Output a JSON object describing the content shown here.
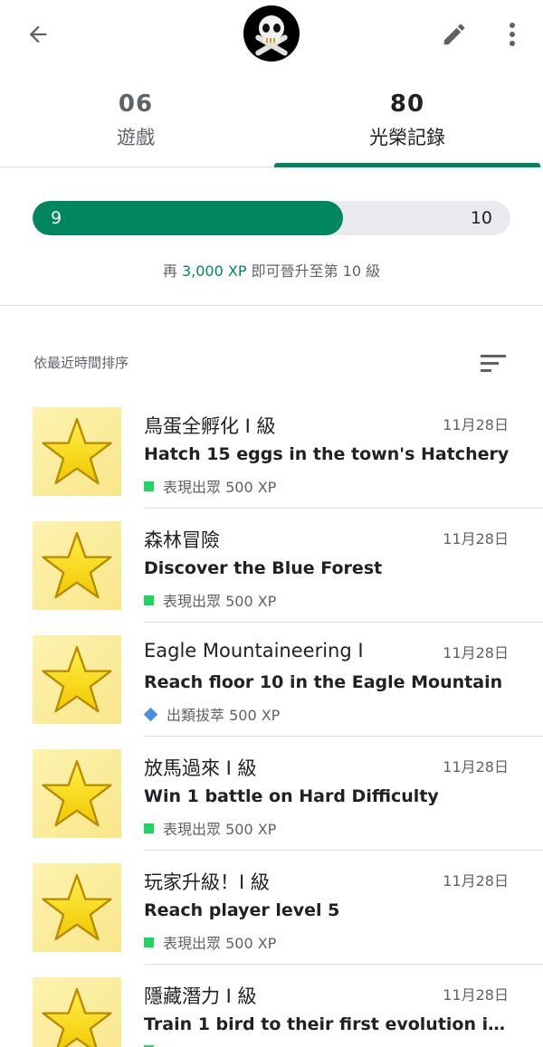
{
  "header": {
    "icons": {
      "back": "arrow-left-icon",
      "avatar": "skull-crossbones-avatar",
      "edit": "pencil-icon",
      "more": "more-vert-icon"
    }
  },
  "tabs": [
    {
      "count": "06",
      "label": "遊戲",
      "active": false
    },
    {
      "count": "80",
      "label": "光榮記錄",
      "active": true
    }
  ],
  "level": {
    "current": "9",
    "next": "10",
    "progress_fraction": 0.65,
    "caption_prefix": "再 ",
    "caption_xp": "3,000 XP",
    "caption_suffix": " 即可晉升至第 10 級"
  },
  "sort": {
    "label": "依最近時間排序",
    "icon": "sort-icon"
  },
  "colors": {
    "accent": "#01875f",
    "common": "#1ed760",
    "rare": "#4a90e2"
  },
  "achievements": [
    {
      "title": "鳥蛋全孵化 I 級",
      "date": "11月28日",
      "desc": "Hatch 15 eggs in the town's Hatchery",
      "rarity": "表現出眾 500 XP",
      "rarity_icon": "square"
    },
    {
      "title": "森林冒險",
      "date": "11月28日",
      "desc": "Discover the Blue Forest",
      "rarity": "表現出眾 500 XP",
      "rarity_icon": "square"
    },
    {
      "title": "Eagle Mountaineering I",
      "date": "11月28日",
      "desc": "Reach floor 10 in the Eagle Mountain",
      "rarity": "出類拔萃 500 XP",
      "rarity_icon": "diamond"
    },
    {
      "title": "放馬過來 I 級",
      "date": "11月28日",
      "desc": "Win 1 battle on Hard Difficulty",
      "rarity": "表現出眾 500 XP",
      "rarity_icon": "square"
    },
    {
      "title": "玩家升級！I 級",
      "date": "11月28日",
      "desc": "Reach player level 5",
      "rarity": "表現出眾 500 XP",
      "rarity_icon": "square"
    },
    {
      "title": "隱藏潛力 I 級",
      "date": "11月28日",
      "desc": "Train 1 bird to their first evolution in the...",
      "rarity": "",
      "rarity_icon": "square"
    }
  ]
}
